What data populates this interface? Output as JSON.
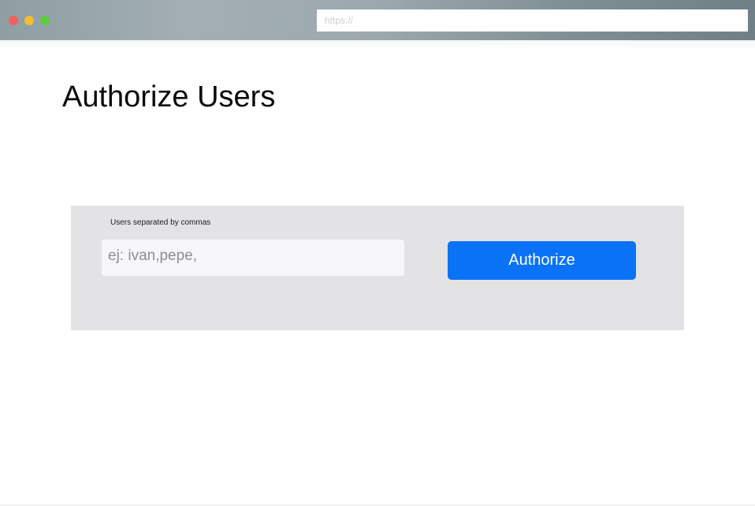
{
  "browser": {
    "url_placeholder": "https://",
    "controls": {
      "close_color": "#f0605a",
      "minimize_color": "#f4be2f",
      "maximize_color": "#5ccc3d"
    }
  },
  "page": {
    "title": "Authorize Users"
  },
  "form": {
    "users_label": "Users separated by commas",
    "users_placeholder": "ej: ivan,pepe,",
    "users_value": "",
    "submit_label": "Authorize",
    "accent_color": "#0a72f7",
    "panel_color": "#e3e3e6"
  }
}
